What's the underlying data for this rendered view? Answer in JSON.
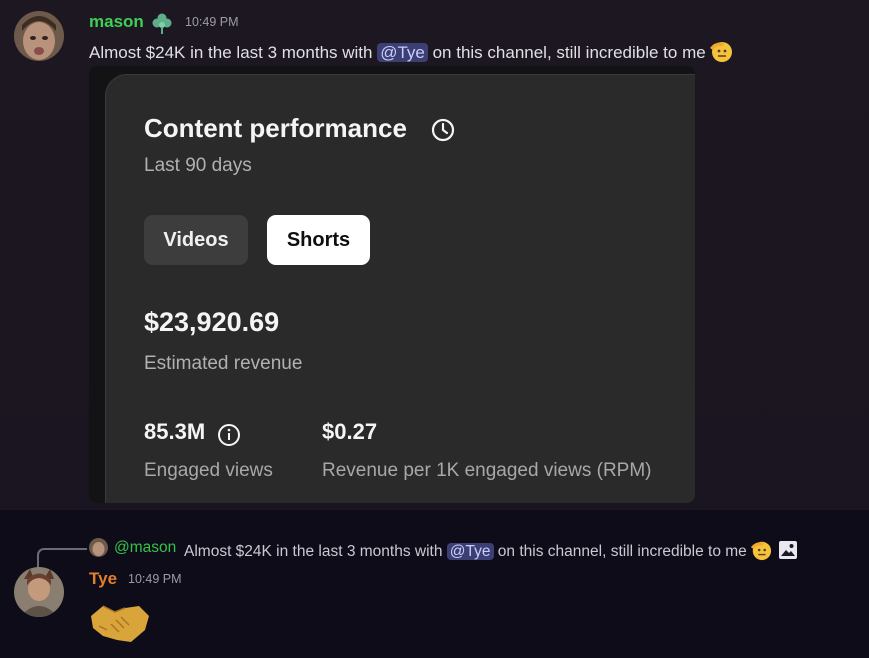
{
  "messages": [
    {
      "username": "mason",
      "username_color": "#3fcf56",
      "timestamp": "10:49 PM",
      "text_before": "Almost $24K in the last 3 months with ",
      "mention": "@Tye",
      "text_after": " on this channel, still incredible to me",
      "badge_icon": "clover-icon",
      "emoji": "saluting-face-emoji",
      "embed": {
        "title": "Content performance",
        "subtitle": "Last 90 days",
        "tabs": [
          {
            "label": "Videos",
            "selected": false
          },
          {
            "label": "Shorts",
            "selected": true
          }
        ],
        "revenue_value": "$23,920.69",
        "revenue_label": "Estimated revenue",
        "stats": [
          {
            "value": "85.3M",
            "label": "Engaged views"
          },
          {
            "value": "$0.27",
            "label": "Revenue per 1K engaged views (RPM)"
          }
        ]
      }
    },
    {
      "username": "Tye",
      "username_color": "#e0802f",
      "timestamp": "10:49 PM",
      "reply": {
        "username": "@mason",
        "text_before": "Almost $24K in the last 3 months with ",
        "mention": "@Tye",
        "text_after": " on this channel, still incredible to me"
      },
      "content_emoji": "handshake-emoji"
    }
  ]
}
